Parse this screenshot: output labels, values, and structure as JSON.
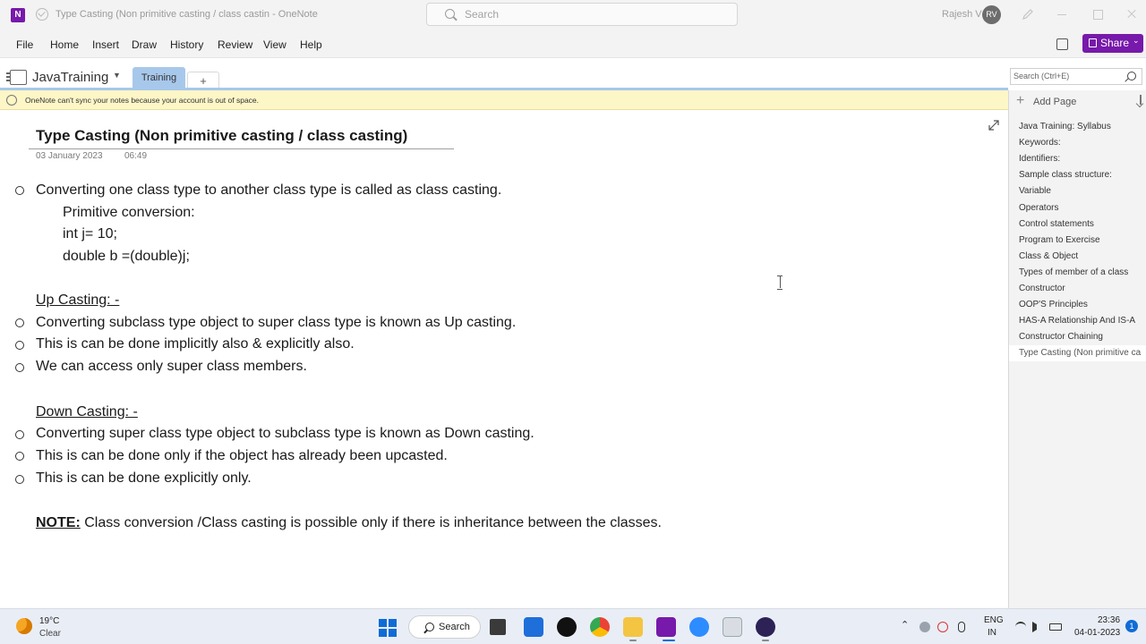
{
  "titlebar": {
    "window_title": "Type Casting (Non primitive casting / class castin  -  OneNote",
    "app_logo": "N",
    "search_placeholder": "Search",
    "user_name": "Rajesh V",
    "avatar_initials": "RV"
  },
  "menu": {
    "items": [
      "File",
      "Home",
      "Insert",
      "Draw",
      "History",
      "Review",
      "View",
      "Help"
    ],
    "share_label": "Share"
  },
  "notebook": {
    "name": "JavaTraining",
    "section_tab": "Training",
    "add_section": "+",
    "page_search_placeholder": "Search (Ctrl+E)"
  },
  "infobar": {
    "message": "OneNote can't sync your notes because your account is out of space."
  },
  "page": {
    "title": "Type Casting (Non primitive casting / class casting)",
    "date": "03 January 2023",
    "time": "06:49",
    "line1": "Converting one class type to another class type is called as class casting.",
    "line2": "Primitive conversion:",
    "line3": "int  j= 10;",
    "line4": "double b =(double)j;",
    "upcasting_heading": "Up Casting: -",
    "up1": "Converting subclass type object to super class type is known as Up casting.",
    "up2": "This is can be done implicitly also & explicitly also.",
    "up3": "We can access only super class members.",
    "downcasting_heading": "Down Casting: -",
    "down1": "Converting super class type object to subclass type is known as Down casting.",
    "down2": "This is can be done only if the object has already been upcasted.",
    "down3": "This is can be done explicitly only.",
    "note_label": "NOTE:",
    "note_text": " Class conversion /Class casting is possible only if there is inheritance between the classes."
  },
  "pages_pane": {
    "add_page": "Add Page",
    "pages": [
      "Java Training: Syllabus",
      "Keywords:",
      "Identifiers:",
      "Sample class structure:",
      "Variable",
      "Operators",
      "Control statements",
      "Program to Exercise",
      "Class & Object",
      "Types of member of a class",
      "Constructor",
      "OOP'S Principles",
      "HAS-A Relationship And IS-A",
      "Constructor Chaining",
      "Type Casting (Non primitive ca"
    ],
    "active_index": 14
  },
  "taskbar": {
    "temperature": "19°C",
    "condition": "Clear",
    "search_label": "Search",
    "language_top": "ENG",
    "language_bottom": "IN",
    "clock_time": "23:36",
    "clock_date": "04-01-2023",
    "notification_count": "1"
  },
  "colors": {
    "onenote_purple": "#7719aa",
    "section_tab_blue": "#a7c8eb",
    "infobar_yellow": "#fdf6c7",
    "windows_blue": "#0f6cd6"
  }
}
